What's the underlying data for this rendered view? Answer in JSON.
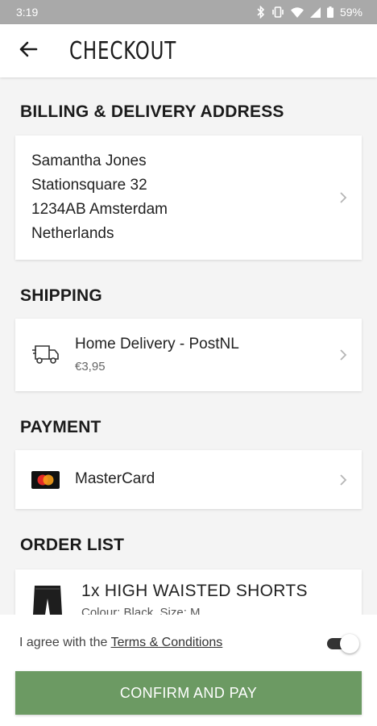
{
  "status_bar": {
    "time": "3:19",
    "battery": "59%"
  },
  "header": {
    "title": "CHECKOUT"
  },
  "billing": {
    "title": "BILLING & DELIVERY ADDRESS",
    "lines": [
      "Samantha Jones",
      "Stationsquare 32",
      "1234AB Amsterdam",
      "Netherlands"
    ]
  },
  "shipping": {
    "title": "SHIPPING",
    "method": "Home Delivery - PostNL",
    "price": "€3,95",
    "icon": "delivery-truck-icon"
  },
  "payment": {
    "title": "PAYMENT",
    "method": "MasterCard",
    "icon": "mastercard-icon"
  },
  "order": {
    "title": "ORDER LIST",
    "items": [
      {
        "title": "1x HIGH WAISTED SHORTS",
        "details": "Colour: Black, Size: M"
      }
    ]
  },
  "footer": {
    "terms_prefix": "I agree with the ",
    "terms_link": "Terms & Conditions",
    "confirm_label": "CONFIRM AND PAY"
  },
  "colors": {
    "accent": "#6c9a63",
    "status_bar": "#a9a9a9",
    "background": "#f4f4f4"
  }
}
